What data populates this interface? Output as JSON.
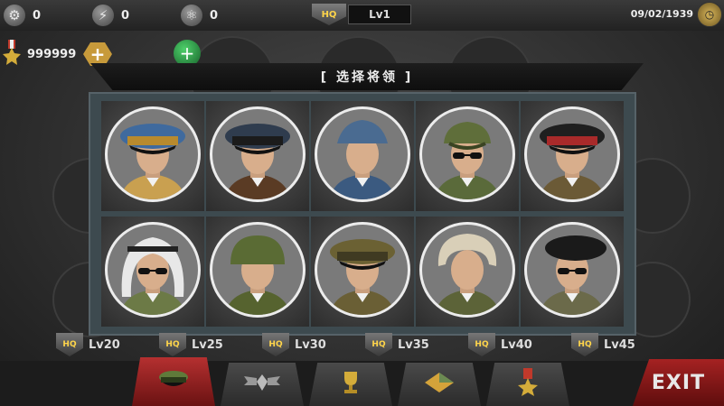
{
  "top_bar": {
    "resources": [
      {
        "icon": "gear-icon",
        "value": "0"
      },
      {
        "icon": "lightning-icon",
        "value": "0"
      },
      {
        "icon": "atom-icon",
        "value": "0"
      }
    ],
    "hq_badge": "HQ",
    "level": "Lv1",
    "date": "09/02/1939",
    "clock_icon": "clock-icon"
  },
  "money": {
    "icon": "medal-icon",
    "value": "999999",
    "add_icon": "plus-icon"
  },
  "dialog": {
    "title": "[ 选择将领 ]",
    "generals": [
      {
        "cap": "peaked-cap-blue",
        "cap_color": "#3f6a9e",
        "band": "#b88a2e",
        "glasses": false,
        "uniform": "#c9a050"
      },
      {
        "cap": "peaked-cap-navy",
        "cap_color": "#2f3c4e",
        "band": "#1b1b1b",
        "glasses": false,
        "uniform": "#5a3b24"
      },
      {
        "cap": "garrison-cap-blue",
        "cap_color": "#4a6b91",
        "band": "#4a6b91",
        "glasses": false,
        "uniform": "#3b5a80"
      },
      {
        "cap": "field-cap-olive",
        "cap_color": "#5f6e3a",
        "band": "#5f6e3a",
        "glasses": true,
        "uniform": "#5a6a3a"
      },
      {
        "cap": "kepi-red-black",
        "cap_color": "#1f1f1f",
        "band": "#a82a2a",
        "glasses": false,
        "uniform": "#6b5a36"
      },
      {
        "cap": "keffiyeh",
        "cap_color": "#e8e8e8",
        "band": "#222222",
        "glasses": true,
        "uniform": "#6c7a46"
      },
      {
        "cap": "helmet-olive",
        "cap_color": "#5a6b34",
        "band": "#5a6b34",
        "glasses": false,
        "uniform": "#56632f"
      },
      {
        "cap": "peaked-cap-khaki",
        "cap_color": "#6b6133",
        "band": "#3f3a22",
        "glasses": false,
        "uniform": "#6a5f35"
      },
      {
        "cap": "fur-hat",
        "cap_color": "#d9cfb8",
        "band": "#d9cfb8",
        "glasses": false,
        "uniform": "#5c6338"
      },
      {
        "cap": "beret-black",
        "cap_color": "#1a1a1a",
        "band": "#1a1a1a",
        "glasses": true,
        "uniform": "#6b6a4a"
      }
    ]
  },
  "levels": [
    {
      "badge": "HQ",
      "label": "Lv20"
    },
    {
      "badge": "HQ",
      "label": "Lv25"
    },
    {
      "badge": "HQ",
      "label": "Lv30"
    },
    {
      "badge": "HQ",
      "label": "Lv35"
    },
    {
      "badge": "HQ",
      "label": "Lv40"
    },
    {
      "badge": "HQ",
      "label": "Lv45"
    }
  ],
  "tabs": [
    {
      "icon": "general-cap-icon",
      "active": true
    },
    {
      "icon": "wings-emblem-icon",
      "active": false
    },
    {
      "icon": "trophy-icon",
      "active": false
    },
    {
      "icon": "diamond-icon",
      "active": false
    },
    {
      "icon": "medal-icon",
      "active": false
    }
  ],
  "exit_label": "EXIT",
  "colors": {
    "panel": "#3d4a4f",
    "exit": "#a52222",
    "gold": "#ffd54a"
  }
}
